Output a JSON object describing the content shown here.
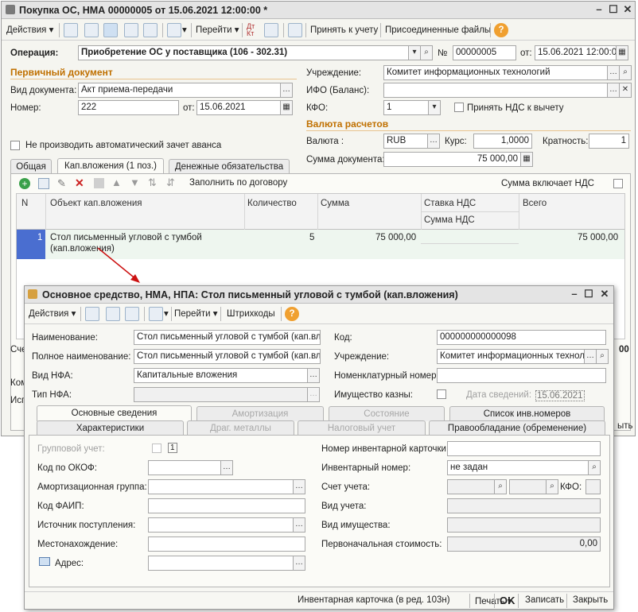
{
  "main": {
    "title": "Покупка ОС, НМА 00000005 от 15.06.2021 12:00:00 *",
    "toolbar": {
      "actions": "Действия",
      "goto": "Перейти",
      "accept": "Принять к учету",
      "attached": "Присоединенные файлы",
      "help": "?"
    },
    "operation_label": "Операция:",
    "operation_value": "Приобретение ОС у поставщика (106 - 302.31)",
    "number_sign": "№",
    "doc_number": "00000005",
    "from_label": "от:",
    "doc_date": "15.06.2021 12:00:00",
    "primary_doc": "Первичный документ",
    "doctype_label": "Вид документа:",
    "doctype_value": "Акт приема-передачи",
    "number_label": "Номер:",
    "number_value": "222",
    "from2_label": "от:",
    "date2_value": "15.06.2021",
    "institution_label": "Учреждение:",
    "institution_value": "Комитет информационных технологий",
    "ifo_label": "ИФО (Баланс):",
    "ifo_value": "",
    "kfo_label": "КФО:",
    "kfo_value": "1",
    "vat_accept_label": "Принять НДС к вычету",
    "currency_section": "Валюта расчетов",
    "currency_label": "Валюта :",
    "currency_value": "RUB",
    "rate_label": "Курс:",
    "rate_value": "1,0000",
    "multiplicity_label": "Кратность:",
    "multiplicity_value": "1",
    "doc_sum_label": "Сумма документа:",
    "doc_sum_value": "75 000,00",
    "no_advance_label": "Не производить автоматический зачет аванса",
    "tabs": [
      "Общая",
      "Кап.вложения (1 поз.)",
      "Денежные обязательства"
    ],
    "fill_by_contract": "Заполнить по договору",
    "sum_incl_vat": "Сумма включает НДС",
    "grid_headers": {
      "n": "N",
      "object": "Объект кап.вложения",
      "qty": "Количество",
      "sum": "Сумма",
      "vat_rate": "Ставка НДС",
      "vat_sum": "Сумма НДС",
      "total": "Всего"
    },
    "rows": [
      {
        "n": "1",
        "object_line1": "Стол письменный угловой с тумбой",
        "object_line2": "(кап.вложения)",
        "qty": "5",
        "sum": "75 000,00",
        "vat_rate": "",
        "vat_sum": "",
        "total": "75 000,00"
      }
    ],
    "hidden_left_1": "Сче",
    "hidden_left_2": "Ком",
    "hidden_left_3": "Исп",
    "hidden_right_1": "00",
    "hidden_right_2": "ыть"
  },
  "dialog": {
    "title": "Основное средство, НМА, НПА: Стол письменный угловой с тумбой (кап.вложения)",
    "toolbar": {
      "actions": "Действия",
      "goto": "Перейти",
      "barcodes": "Штрихкоды",
      "help": "?"
    },
    "name_label": "Наименование:",
    "name_value": "Стол письменный угловой с тумбой (кап.вло:",
    "full_name_label": "Полное наименование:",
    "full_name_value": "Стол письменный угловой с тумбой (кап.вло:",
    "nfa_kind_label": "Вид НФА:",
    "nfa_kind_value": "Капитальные вложения",
    "nfa_type_label": "Тип НФА:",
    "nfa_type_value": "",
    "code_label": "Код:",
    "code_value": "000000000000098",
    "institution_label": "Учреждение:",
    "institution_value": "Комитет информационных технолог",
    "nomenclature_label": "Номенклатурный номер:",
    "nomenclature_value": "",
    "treasury_label": "Имущество казны:",
    "info_date_label": "Дата сведений:",
    "info_date_value": "15.06.2021",
    "tabs_row1": [
      "Основные сведения",
      "Амортизация",
      "Состояние",
      "Список инв.номеров"
    ],
    "tabs_row2": [
      "Характеристики",
      "Драг. металлы",
      "Налоговый учет",
      "Правообладание (обременение)"
    ],
    "group_label": "Групповой учет:",
    "group_count": "1",
    "okof_label": "Код по ОКОФ:",
    "amort_group_label": "Амортизационная группа:",
    "faip_label": "Код ФАИП:",
    "source_label": "Источник поступления:",
    "location_label": "Местонахождение:",
    "address_label": "Адрес:",
    "inv_card_label": "Номер инвентарной карточки:",
    "inv_number_label": "Инвентарный номер:",
    "inv_number_value": "не задан",
    "account_label": "Счет учета:",
    "kfo_label": "КФО:",
    "accounting_kind_label": "Вид учета:",
    "property_kind_label": "Вид имущества:",
    "initial_cost_label": "Первоначальная стоимость:",
    "initial_cost_value": "0,00",
    "footer": {
      "inv_card": "Инвентарная карточка (в ред. 103н)",
      "print": "Печать",
      "ok": "OK",
      "save": "Записать",
      "close": "Закрыть"
    }
  },
  "colors": {
    "section": "#c07000",
    "arrow": "#cc1111",
    "row_selected": "#eef6ef",
    "n_cell": "#4a6ed0"
  }
}
